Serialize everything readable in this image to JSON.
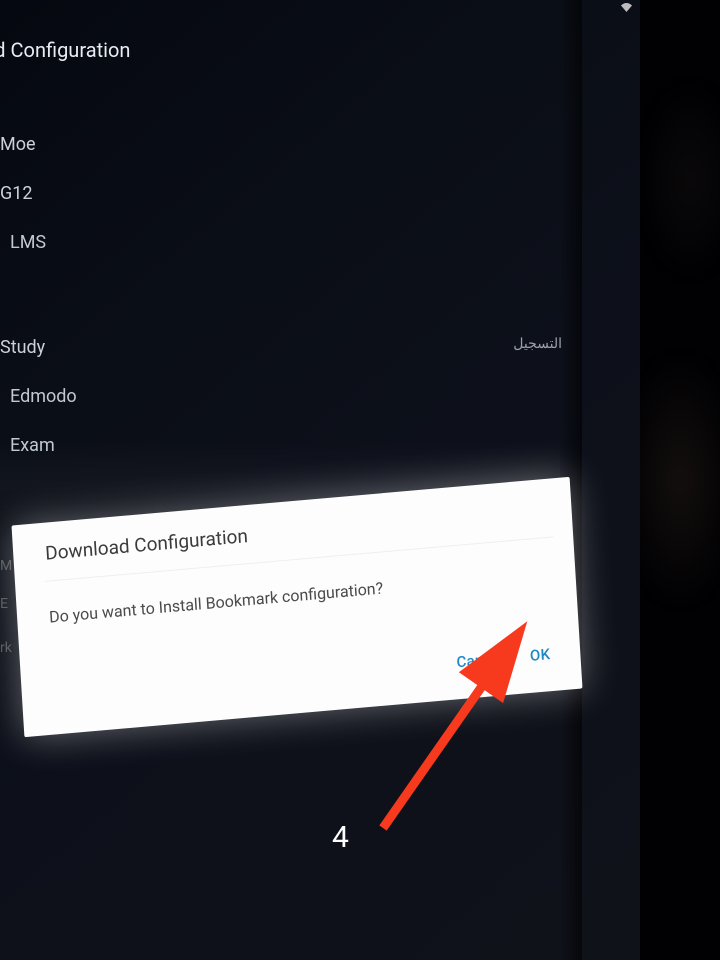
{
  "header": {
    "title": "oad Configuration"
  },
  "list": {
    "moe": "Moe",
    "g12": "G12",
    "lms": "LMS",
    "study": "Study",
    "edmodo": "Edmodo",
    "exam": "Exam"
  },
  "register_label": "التسجيل",
  "truncated": {
    "m": "M",
    "e": "E",
    "rk": "rk"
  },
  "dialog": {
    "title": "Download Configuration",
    "message": "Do you want to Install Bookmark configuration?",
    "cancel": "Cancel",
    "ok": "OK"
  },
  "step_number": "4"
}
